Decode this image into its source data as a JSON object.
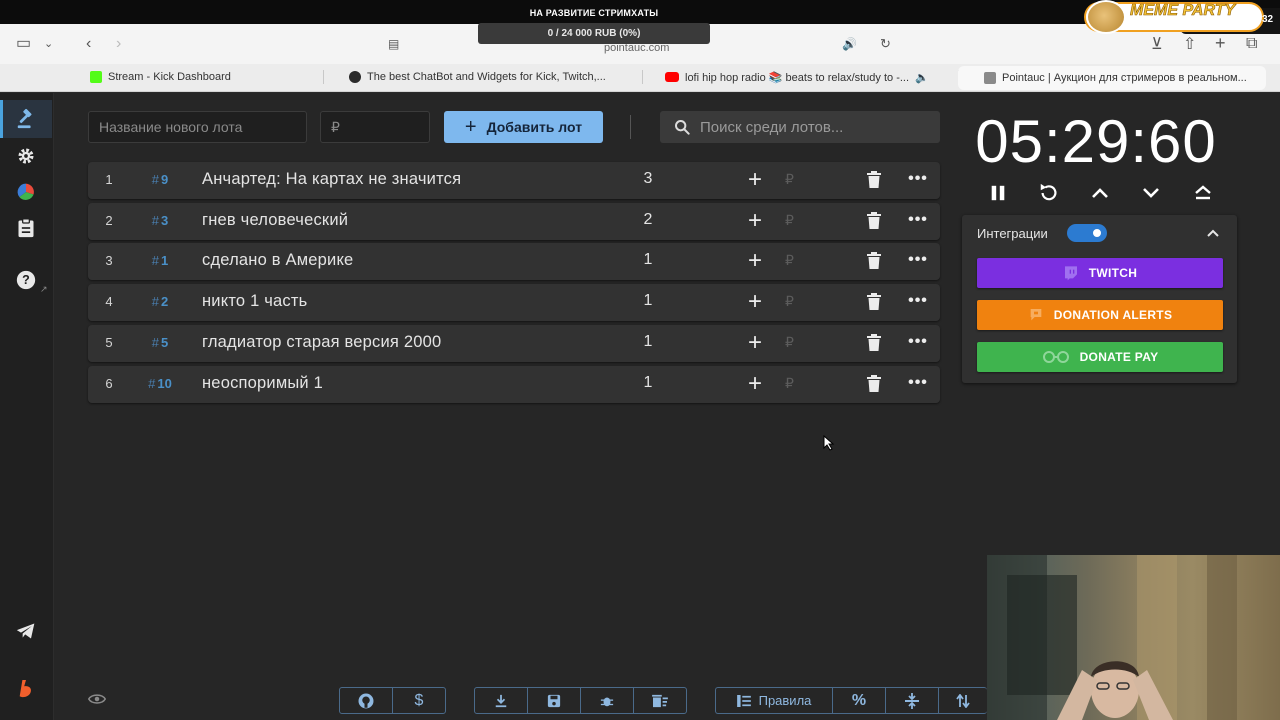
{
  "stream_overlay": {
    "donation_title": "НА РАЗВИТИЕ СТРИМХАТЫ",
    "donation_progress_text": "0 / 24 000 RUB (0%)",
    "donation_progress": 0,
    "meme_title": "MEME PARTY",
    "meme_count": "32"
  },
  "browser": {
    "address_partial": "pointauc.com",
    "tabs": [
      {
        "label": "Stream - Kick Dashboard",
        "favicon_color": "#53fc18"
      },
      {
        "label": "The best ChatBot and Widgets for Kick, Twitch,...",
        "favicon_color": "#2b2b2b"
      },
      {
        "label": "lofi hip hop radio 📚 beats to relax/study to -...",
        "favicon_color": "#ff0000"
      },
      {
        "label": "Pointauc | Аукцион для стримеров в реальном...",
        "favicon_color": "#8a8a8a"
      }
    ]
  },
  "form": {
    "lot_name_placeholder": "Название нового лота",
    "price_placeholder": "₽",
    "add_button_label": "Добавить лот",
    "search_placeholder": "Поиск среди лотов..."
  },
  "lots": [
    {
      "index": "1",
      "id": "9",
      "name": "Анчартед: На картах не значится",
      "amount": "3"
    },
    {
      "index": "2",
      "id": "3",
      "name": "гнев человеческий",
      "amount": "2"
    },
    {
      "index": "3",
      "id": "1",
      "name": "сделано в Америке",
      "amount": "1"
    },
    {
      "index": "4",
      "id": "2",
      "name": "никто 1 часть",
      "amount": "1"
    },
    {
      "index": "5",
      "id": "5",
      "name": "гладиатор старая версия 2000",
      "amount": "1"
    },
    {
      "index": "6",
      "id": "10",
      "name": "неоспоримый 1",
      "amount": "1"
    }
  ],
  "row_icons": {
    "add": "+",
    "currency": "₽",
    "more": "•••"
  },
  "timer": {
    "display": "05:29:60"
  },
  "integrations": {
    "label": "Интеграции",
    "enabled": true,
    "buttons": [
      {
        "label": "TWITCH",
        "color": "#7b2fe0"
      },
      {
        "label": "DONATION ALERTS",
        "color": "#f0820f"
      },
      {
        "label": "DONATE PAY",
        "color": "#3fb44e"
      }
    ]
  },
  "bottom_toolbar": {
    "rules_label": "Правила"
  },
  "colors": {
    "accent": "#7eb8ee",
    "lot_id": "#4a90c8",
    "background": "#262626",
    "row": "#323232"
  }
}
